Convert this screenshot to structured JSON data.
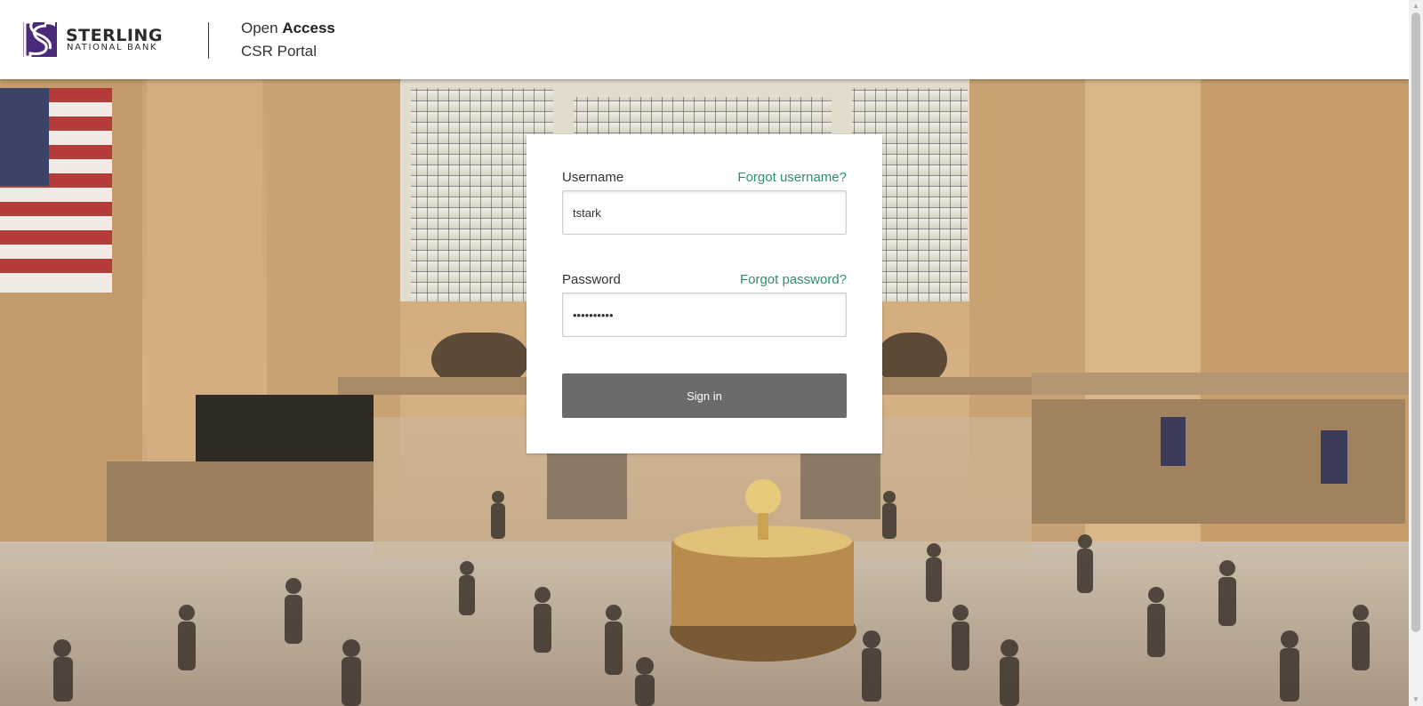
{
  "brand": {
    "name_line_1": "STERLING",
    "name_line_2": "NATIONAL BANK",
    "logo_icon": "sterling-s-logo",
    "logo_color": "#4b2a7b"
  },
  "portal": {
    "line_1_prefix": "Open",
    "line_1_strong": "Access",
    "line_2": "CSR Portal"
  },
  "login": {
    "username_label": "Username",
    "forgot_username": "Forgot username?",
    "username_value": "tstark",
    "password_label": "Password",
    "forgot_password": "Forgot password?",
    "password_value": "••••••••••",
    "sign_in_label": "Sign in",
    "link_color": "#2e8f6d",
    "button_color": "#6b6b6b"
  },
  "background": {
    "scene": "grand-central-terminal-concourse-photo"
  }
}
